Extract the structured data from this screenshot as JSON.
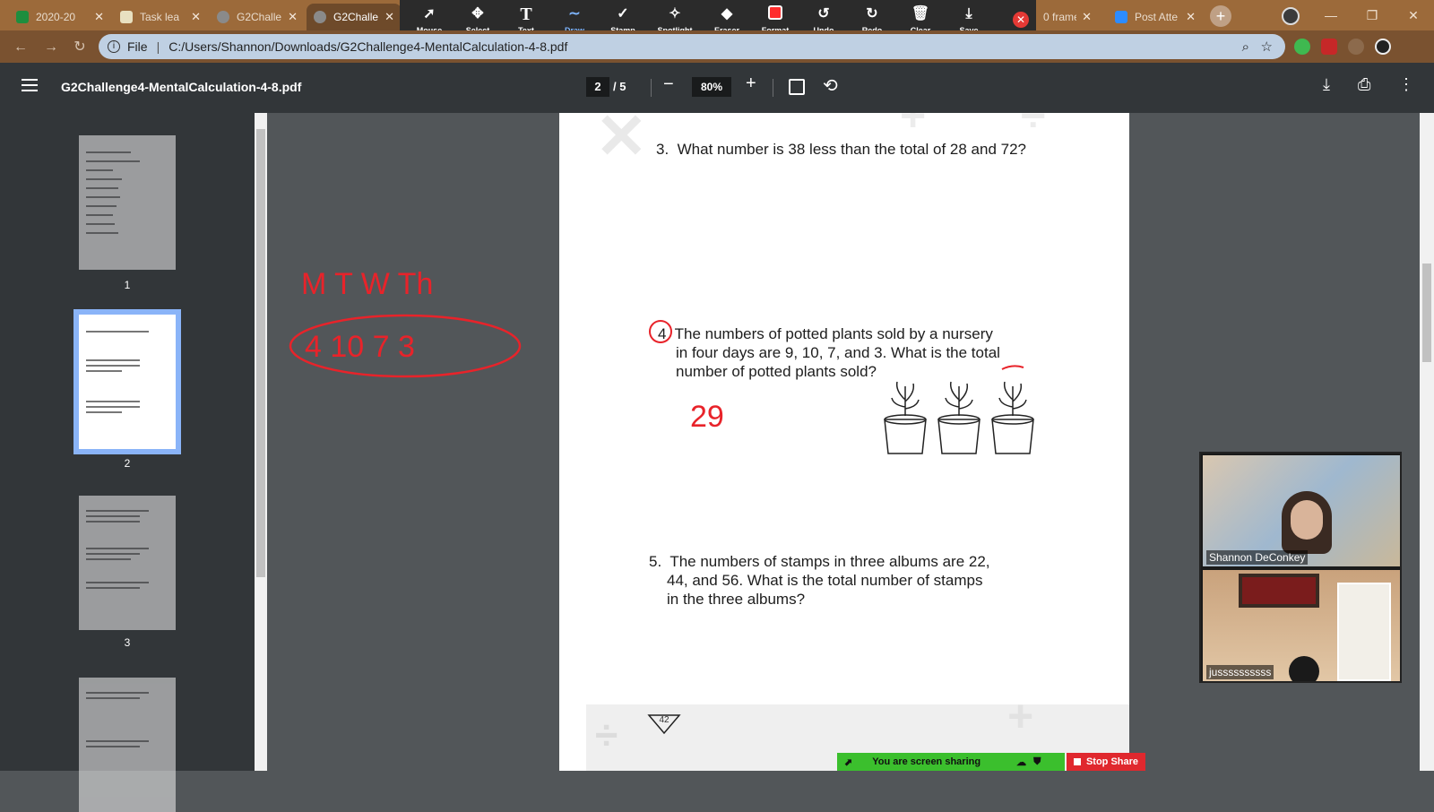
{
  "tabs": [
    {
      "label": "2020-20",
      "icon": "sheets-icon",
      "color": "#1e8e3e"
    },
    {
      "label": "Task lea",
      "icon": "task-icon",
      "color": "#e8e0c0"
    },
    {
      "label": "G2Challe",
      "icon": "globe-icon",
      "color": "#8a8a8a"
    },
    {
      "label": "G2Challe",
      "icon": "globe-icon",
      "color": "#8a8a8a",
      "active": true
    },
    {
      "label": "0 frame",
      "icon": "error-icon",
      "color": "#e53935"
    },
    {
      "label": "Post Atte",
      "icon": "zoom-icon",
      "color": "#2d8cff"
    }
  ],
  "annotation_toolbar": {
    "tools": [
      "Mouse",
      "Select",
      "Text",
      "Draw",
      "Stamp",
      "Spotlight",
      "Eraser",
      "Format",
      "Undo",
      "Redo",
      "Clear",
      "Save"
    ],
    "active_tool": "Draw"
  },
  "address_bar": {
    "scheme_label": "File",
    "url": "C:/Users/Shannon/Downloads/G2Challenge4-MentalCalculation-4-8.pdf"
  },
  "viewer": {
    "title": "G2Challenge4-MentalCalculation-4-8.pdf",
    "current_page": "2",
    "total_pages": "/ 5",
    "zoom": "80%",
    "minus": "−",
    "plus": "+"
  },
  "thumbnails": [
    {
      "number": "1",
      "selected": false
    },
    {
      "number": "2",
      "selected": true
    },
    {
      "number": "3",
      "selected": false
    }
  ],
  "page": {
    "questions": [
      {
        "number": "3.",
        "lines": [
          "What number is 38 less than the total of 28 and 72?"
        ]
      },
      {
        "number": "4",
        "lines": [
          "The numbers of potted plants sold by a nursery",
          "in four days are 9, 10, 7, and 3. What is the total",
          "number of potted plants sold?"
        ]
      },
      {
        "number": "5.",
        "lines": [
          "The numbers of stamps in three albums are 22,",
          "44, and 56. What is the total number of stamps",
          "in the three albums?"
        ]
      }
    ],
    "page_number": "42"
  },
  "annotations": {
    "days": "M T W Th",
    "values": "4 10 7 3",
    "answer": "29",
    "ink_color": "#e8232a"
  },
  "video": {
    "participants": [
      "Shannon DeConkey",
      "jussssssssss"
    ]
  },
  "share": {
    "status": "You are screen sharing",
    "stop_label": "Stop Share"
  }
}
